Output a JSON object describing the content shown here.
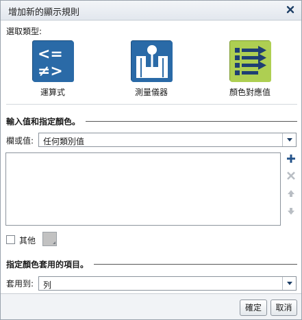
{
  "dialog": {
    "title": "增加新的顯示規則"
  },
  "rule_type": {
    "label": "選取類型:",
    "options": [
      {
        "label": "運算式",
        "icon": "operator-icon"
      },
      {
        "label": "測量儀器",
        "icon": "gauge-icon"
      },
      {
        "label": "顏色對應值",
        "icon": "color-map-icon",
        "selected": true
      }
    ]
  },
  "values_section": {
    "title": "輸入值和指定顏色。",
    "column_label": "欄或值:",
    "column_value": "任何類別值",
    "other_label": "其他"
  },
  "apply_section": {
    "title": "指定顏色套用的項目。",
    "apply_label": "套用到:",
    "apply_value": "列"
  },
  "footer": {
    "ok_label": "確定",
    "cancel_label": "取消"
  },
  "colors": {
    "icon_blue": "#1f5f9a",
    "selected_bg": "#aecf52",
    "accent": "#24538a"
  }
}
